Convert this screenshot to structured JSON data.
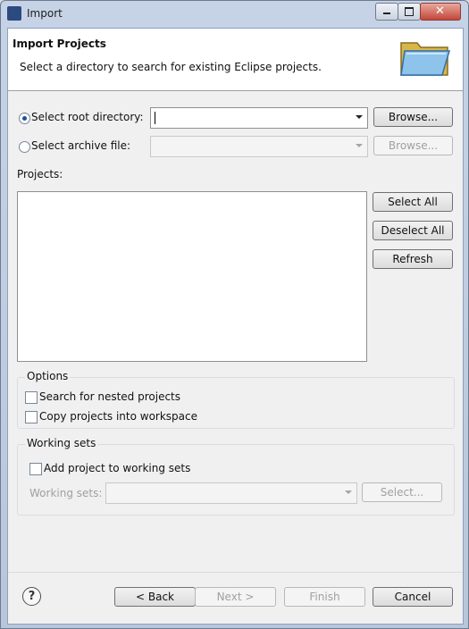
{
  "window": {
    "title": "Import",
    "icon": "eclipse-icon"
  },
  "header": {
    "title": "Import Projects",
    "description": "Select a directory to search for existing Eclipse projects.",
    "icon": "folder-open-icon"
  },
  "source": {
    "root_directory": {
      "label": "Select root directory:",
      "value": "",
      "selected": true,
      "browse_label": "Browse..."
    },
    "archive_file": {
      "label": "Select archive file:",
      "value": "",
      "selected": false,
      "browse_label": "Browse..."
    }
  },
  "projects": {
    "label": "Projects:",
    "items": [],
    "select_all_label": "Select All",
    "deselect_all_label": "Deselect All",
    "refresh_label": "Refresh"
  },
  "options": {
    "title": "Options",
    "search_nested_label": "Search for nested projects",
    "search_nested_checked": false,
    "copy_into_workspace_label": "Copy projects into workspace",
    "copy_into_workspace_checked": false
  },
  "working_sets": {
    "title": "Working sets",
    "add_label": "Add project to working sets",
    "add_checked": false,
    "sets_label": "Working sets:",
    "sets_value": "",
    "select_label": "Select..."
  },
  "footer": {
    "back_label": "< Back",
    "next_label": "Next >",
    "finish_label": "Finish",
    "cancel_label": "Cancel"
  }
}
